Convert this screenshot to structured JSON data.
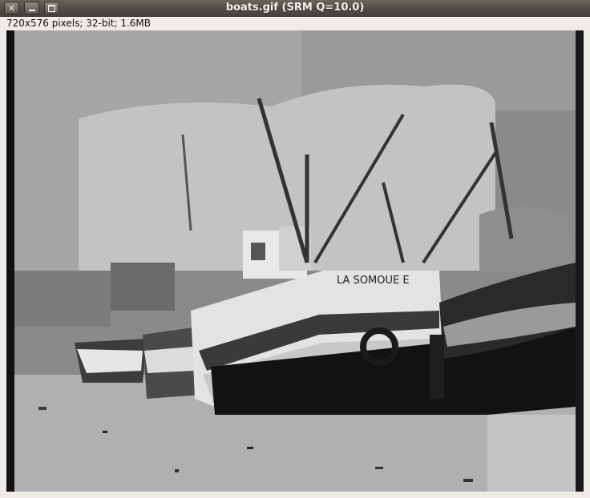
{
  "window": {
    "title": "boats.gif (SRM Q=10.0)",
    "close_glyph": "✕"
  },
  "image_info": "720x576 pixels; 32-bit; 1.6MB",
  "image": {
    "description_icon": "segmented-boat-photo",
    "palette": [
      "#000000",
      "#1c1c1c",
      "#3a3a3a",
      "#555555",
      "#6e6e6e",
      "#8a8a8a",
      "#a2a2a2",
      "#b8b8b8",
      "#c8c8c8",
      "#dcdcdc",
      "#efefef"
    ]
  }
}
